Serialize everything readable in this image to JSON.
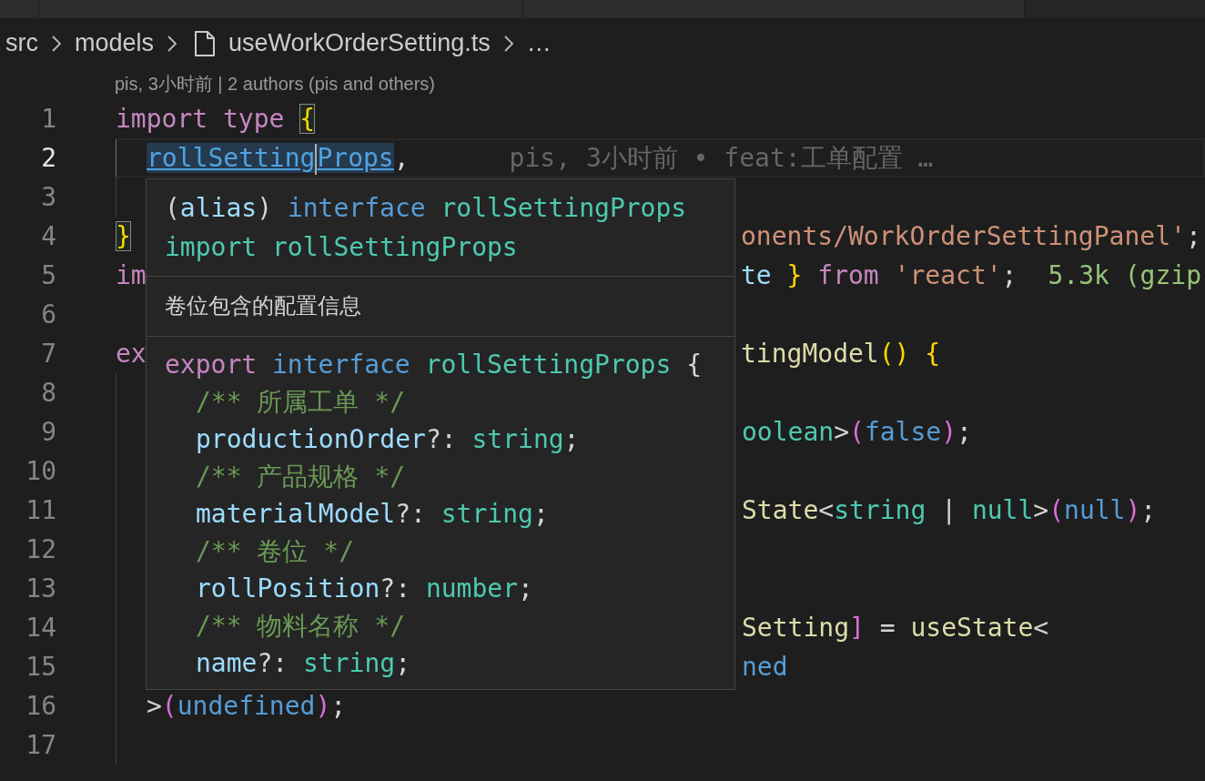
{
  "tabs": [
    {
      "selected": false
    },
    {
      "selected": false
    },
    {
      "selected": false
    }
  ],
  "breadcrumb": [
    {
      "kind": "folder",
      "label": "src"
    },
    {
      "kind": "folder",
      "label": "models"
    },
    {
      "kind": "file",
      "label": "useWorkOrderSetting.ts"
    },
    {
      "kind": "more",
      "label": "…"
    }
  ],
  "codelens": "pis, 3小时前 | 2 authors (pis and others)",
  "lines": [
    {
      "number": "1",
      "active": false,
      "left": [
        {
          "text": "import",
          "kind": "keyword"
        },
        {
          "text": " type ",
          "kind": "keyword"
        },
        {
          "text": "{",
          "kind": "bracket",
          "matched": true
        }
      ]
    },
    {
      "number": "2",
      "active": true,
      "indented": true,
      "left": [
        {
          "text": "rollSetting",
          "kind": "link",
          "caret": true
        },
        {
          "text": "Props",
          "kind": "link"
        },
        {
          "text": ","
        }
      ],
      "blame": "pis, 3小时前 • feat:工单配置 …"
    },
    {
      "number": "3",
      "active": false
    },
    {
      "number": "4",
      "active": false,
      "left": [
        {
          "text": "}",
          "kind": "bracket",
          "matched": true
        }
      ],
      "right": [
        {
          "text": "onents/WorkOrderSettingPanel'",
          "kind": "string"
        },
        {
          "text": ";"
        }
      ]
    },
    {
      "number": "5",
      "active": false,
      "left": [
        {
          "text": "im",
          "kind": "keyword"
        }
      ],
      "right": [
        {
          "text": "te",
          "kind": "variable"
        },
        {
          "text": " }",
          "kind": "bracket"
        },
        {
          "text": " from",
          "kind": "keyword"
        },
        {
          "text": " 'react'",
          "kind": "string"
        },
        {
          "text": ";"
        }
      ],
      "hint": "5.3k (gzip"
    },
    {
      "number": "6",
      "active": false
    },
    {
      "number": "7",
      "active": false,
      "left": [
        {
          "text": "ex",
          "kind": "keyword"
        }
      ],
      "right": [
        {
          "text": "tingModel",
          "kind": "function"
        },
        {
          "text": "()",
          "kind": "bracket"
        },
        {
          "text": " {",
          "kind": "bracket"
        }
      ]
    },
    {
      "number": "8",
      "active": false
    },
    {
      "number": "9",
      "active": false,
      "right": [
        {
          "text": "oolean",
          "kind": "type"
        },
        {
          "text": ">"
        },
        {
          "text": "(",
          "kind": "bracket2"
        },
        {
          "text": "false",
          "kind": "storage"
        },
        {
          "text": ")",
          "kind": "bracket2"
        },
        {
          "text": ";"
        }
      ]
    },
    {
      "number": "10",
      "active": false
    },
    {
      "number": "11",
      "active": false,
      "right": [
        {
          "text": "State",
          "kind": "function"
        },
        {
          "text": "<"
        },
        {
          "text": "string",
          "kind": "type"
        },
        {
          "text": " | "
        },
        {
          "text": "null",
          "kind": "type"
        },
        {
          "text": ">"
        },
        {
          "text": "(",
          "kind": "bracket2"
        },
        {
          "text": "null",
          "kind": "storage"
        },
        {
          "text": ")",
          "kind": "bracket2"
        },
        {
          "text": ";"
        }
      ]
    },
    {
      "number": "12",
      "active": false
    },
    {
      "number": "13",
      "active": false
    },
    {
      "number": "14",
      "active": false,
      "right": [
        {
          "text": "Setting",
          "kind": "function"
        },
        {
          "text": "]",
          "kind": "bracket2"
        },
        {
          "text": " = "
        },
        {
          "text": "useState",
          "kind": "function"
        },
        {
          "text": "<"
        }
      ]
    },
    {
      "number": "15",
      "active": false,
      "right": [
        {
          "text": "ned",
          "kind": "storage"
        }
      ]
    },
    {
      "number": "16",
      "active": false,
      "indented": true,
      "left": [
        {
          "text": ">"
        },
        {
          "text": "(",
          "kind": "bracket2"
        },
        {
          "text": "undefined",
          "kind": "storage"
        },
        {
          "text": ")",
          "kind": "bracket2"
        },
        {
          "text": ";"
        }
      ]
    },
    {
      "number": "17",
      "active": false
    }
  ],
  "hover": {
    "signature": [
      [
        {
          "text": "("
        },
        {
          "text": "alias",
          "kind": "variable"
        },
        {
          "text": ") "
        },
        {
          "text": "interface",
          "kind": "storage"
        },
        {
          "text": " rollSettingProps",
          "kind": "type"
        }
      ],
      [
        {
          "text": "import rollSettingProps",
          "kind": "type"
        }
      ]
    ],
    "doc": "卷位包含的配置信息",
    "definition": [
      [
        {
          "text": "export",
          "kind": "keyword"
        },
        {
          "text": " interface",
          "kind": "storage"
        },
        {
          "text": " rollSettingProps",
          "kind": "type"
        },
        {
          "text": " {"
        }
      ],
      [
        {
          "text": "/** 所属工单 */",
          "kind": "comment"
        }
      ],
      [
        {
          "text": "productionOrder",
          "kind": "variable"
        },
        {
          "text": "?: "
        },
        {
          "text": "string",
          "kind": "type"
        },
        {
          "text": ";"
        }
      ],
      [
        {
          "text": "/** 产品规格 */",
          "kind": "comment"
        }
      ],
      [
        {
          "text": "materialModel",
          "kind": "variable"
        },
        {
          "text": "?: "
        },
        {
          "text": "string",
          "kind": "type"
        },
        {
          "text": ";"
        }
      ],
      [
        {
          "text": "/** 卷位 */",
          "kind": "comment"
        }
      ],
      [
        {
          "text": "rollPosition",
          "kind": "variable"
        },
        {
          "text": "?: "
        },
        {
          "text": "number",
          "kind": "type"
        },
        {
          "text": ";"
        }
      ],
      [
        {
          "text": "/** 物料名称 */",
          "kind": "comment"
        }
      ],
      [
        {
          "text": "name",
          "kind": "variable"
        },
        {
          "text": "?: "
        },
        {
          "text": "string",
          "kind": "type"
        },
        {
          "text": ";"
        }
      ]
    ]
  }
}
